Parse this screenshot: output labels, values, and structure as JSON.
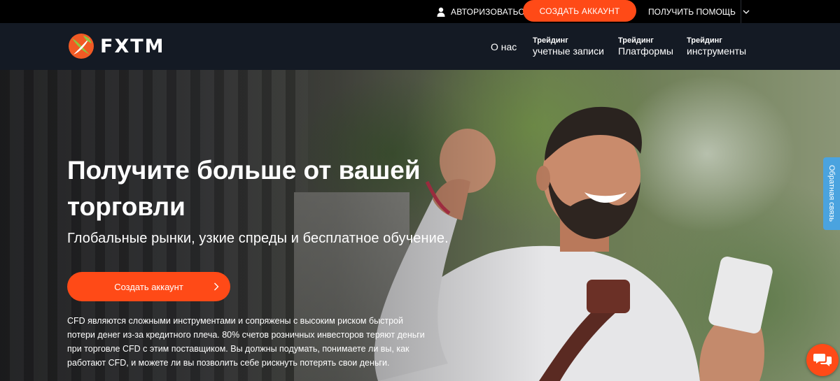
{
  "topbar": {
    "login_label": "АВТОРИЗОВАТЬСЯ",
    "create_account_label": "СОЗДАТЬ АККАУНТ",
    "help_label": "ПОЛУЧИТЬ ПОМОЩЬ"
  },
  "nav": {
    "logo_text": "FXTM",
    "about_label": "О нас",
    "accounts_small": "Трейдинг",
    "accounts_big": "учетные записи",
    "platforms_small": "Трейдинг",
    "platforms_big": "Платформы",
    "instruments_small": "Трейдинг",
    "instruments_big": "инструменты"
  },
  "hero": {
    "title": "Получите больше от вашей торговли",
    "subtitle": "Глобальные рынки, узкие спреды и бесплатное обучение.",
    "cta_label": "Создать аккаунт",
    "risk_warning": "CFD являются сложными инструментами и сопряжены с высоким риском быстрой потери денег из-за кредитного плеча. 80% счетов розничных инвесторов теряют деньги при торговле CFD с этим поставщиком. Вы должны подумать, понимаете ли вы, как работают CFD, и можете ли вы позволить себе рискнуть потерять свои деньги."
  },
  "widgets": {
    "feedback_label": "Обратная связь"
  },
  "icons": {
    "login": "user-icon",
    "help": "chevron-down-icon",
    "cta": "chevron-right-icon",
    "chat": "chat-bubbles-icon"
  },
  "colors": {
    "accent": "#ff4a17",
    "topbar": "#000000",
    "navbar": "#141a24",
    "feedback": "#4aa3df",
    "logo_green": "#8dc63f",
    "logo_orange": "#f15a24"
  }
}
